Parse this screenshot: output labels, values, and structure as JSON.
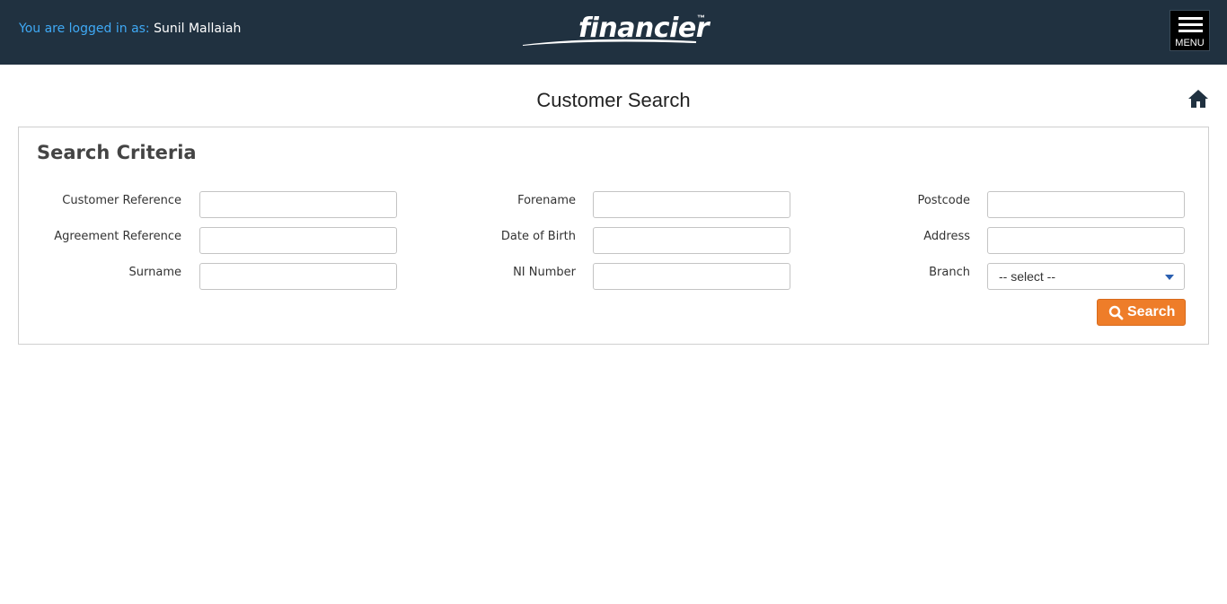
{
  "header": {
    "login_prefix": "You are logged in as: ",
    "login_user": "Sunil Mallaiah",
    "logo_text": "financier",
    "logo_tm": "™",
    "menu_label": "MENU"
  },
  "page": {
    "title": "Customer Search",
    "home_icon": "home-icon"
  },
  "search_panel": {
    "title": "Search Criteria",
    "fields": {
      "customer_reference": {
        "label": "Customer Reference",
        "value": ""
      },
      "agreement_reference": {
        "label": "Agreement Reference",
        "value": ""
      },
      "surname": {
        "label": "Surname",
        "value": ""
      },
      "forename": {
        "label": "Forename",
        "value": ""
      },
      "date_of_birth": {
        "label": "Date of Birth",
        "value": ""
      },
      "ni_number": {
        "label": "NI Number",
        "value": ""
      },
      "postcode": {
        "label": "Postcode",
        "value": ""
      },
      "address": {
        "label": "Address",
        "value": ""
      },
      "branch": {
        "label": "Branch",
        "selected": "-- select --"
      }
    },
    "search_button": {
      "label": "Search",
      "icon": "search-icon"
    }
  },
  "colors": {
    "header_bg": "#203140",
    "login_prefix": "#3fa9f5",
    "accent_button": "#ee7d29",
    "caret": "#2a5fb0"
  }
}
